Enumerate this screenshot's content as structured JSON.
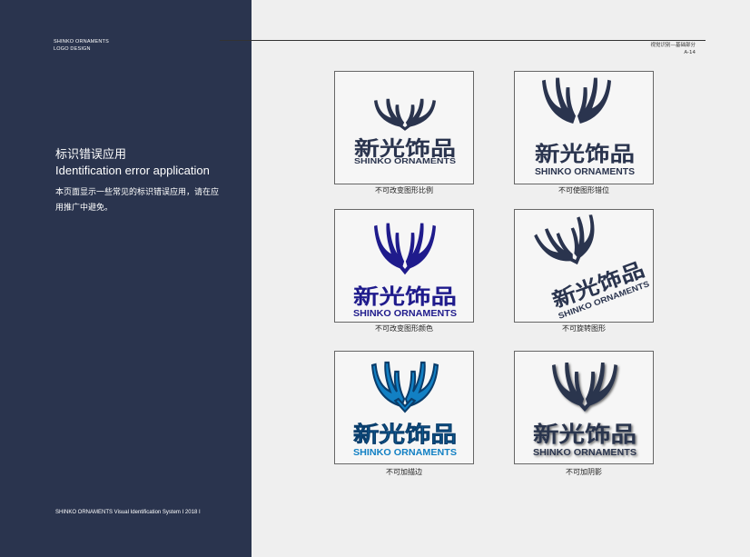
{
  "sidebar": {
    "brand_line1": "SHINKO ORNAMENTS",
    "brand_line2": "LOGO DESIGN",
    "title_cn": "标识错误应用",
    "title_en": "Identification error application",
    "description": "本页面显示一些常见的标识错误应用，请在应用推广中避免。",
    "footer": "SHINKO ORNAMENTS Visual Identification System I  2018 I"
  },
  "header": {
    "section": "视觉识别—基础部分",
    "page": "A-14"
  },
  "logo": {
    "cn": "新光饰品",
    "en": "SHINKO ORNAMENTS"
  },
  "examples": [
    {
      "caption": "不可改变图形比例",
      "color": "#2a344e"
    },
    {
      "caption": "不可使图形错位",
      "color": "#2a344e"
    },
    {
      "caption": "不可改变图形颜色",
      "color": "#1f1b8c"
    },
    {
      "caption": "不可旋转图形",
      "color": "#2a344e"
    },
    {
      "caption": "不可加描边",
      "color": "#1280c4",
      "stroke": "#0a3d6b"
    },
    {
      "caption": "不可加阴影",
      "color": "#2a344e"
    }
  ]
}
